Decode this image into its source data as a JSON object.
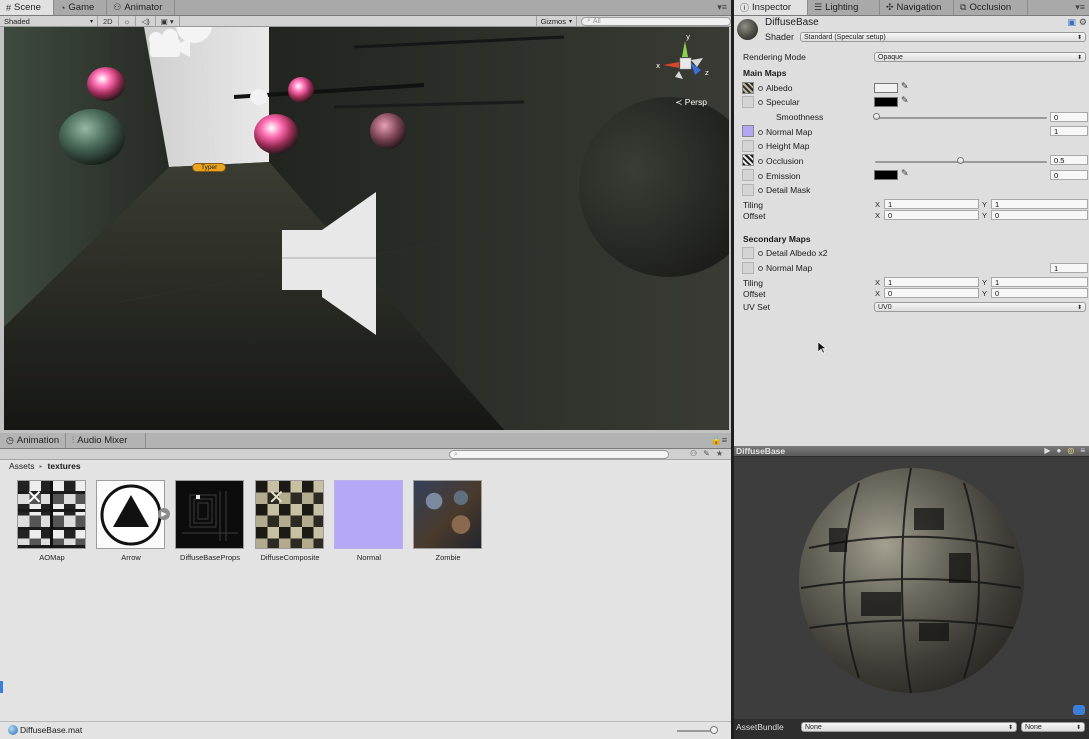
{
  "scene_panel": {
    "tabs": [
      {
        "label": "Scene",
        "icon": "scene-grid-icon",
        "active": true
      },
      {
        "label": "Game",
        "icon": "game-pacman-icon",
        "active": false
      },
      {
        "label": "Animator",
        "icon": "animator-icon",
        "active": false
      }
    ],
    "toolbar": {
      "draw_mode": "Shaded",
      "mode_2d": "2D",
      "gizmos": "Gizmos",
      "search_placeholder": "All"
    },
    "viewport": {
      "camera_mode": "Persp",
      "selected_label": "Typer",
      "gizmo_axes": [
        "y",
        "x",
        "z"
      ]
    }
  },
  "inspector": {
    "tabs": [
      {
        "label": "Inspector",
        "active": true
      },
      {
        "label": "Lighting",
        "active": false
      },
      {
        "label": "Navigation",
        "active": false
      },
      {
        "label": "Occlusion",
        "active": false
      }
    ],
    "material_name": "DiffuseBase",
    "shader_label": "Shader",
    "shader_value": "Standard (Specular setup)",
    "rendering_mode_label": "Rendering Mode",
    "rendering_mode_value": "Opaque",
    "main_maps_title": "Main Maps",
    "albedo": "Albedo",
    "specular": "Specular",
    "smoothness": "Smoothness",
    "smoothness_value": "0",
    "normal_map": "Normal Map",
    "normal_map_value": "1",
    "height_map": "Height Map",
    "occlusion": "Occlusion",
    "occlusion_value": "0.5",
    "emission": "Emission",
    "emission_value": "0",
    "detail_mask": "Detail Mask",
    "tiling": "Tiling",
    "offset": "Offset",
    "tiling_x": "1",
    "tiling_y": "1",
    "offset_x": "0",
    "offset_y": "0",
    "x_label": "X",
    "y_label": "Y",
    "secondary_maps_title": "Secondary Maps",
    "detail_albedo": "Detail Albedo x2",
    "secondary_normal_map": "Normal Map",
    "secondary_normal_value": "1",
    "secondary_tiling_x": "1",
    "secondary_tiling_y": "1",
    "secondary_offset_x": "0",
    "secondary_offset_y": "0",
    "uv_set_label": "UV Set",
    "uv_set_value": "UV0",
    "colors": {
      "albedo": "#f2f2f2",
      "specular": "#000000",
      "emission": "#000000",
      "normal_thumb": "#b3a6f5"
    }
  },
  "preview": {
    "title": "DiffuseBase",
    "asset_bundle_label": "AssetBundle",
    "asset_bundle_value": "None",
    "asset_bundle_variant": "None"
  },
  "project": {
    "tabs": [
      {
        "label": "Animation",
        "active": false
      },
      {
        "label": "Audio Mixer",
        "active": false
      }
    ],
    "breadcrumb": [
      "Assets",
      "textures"
    ],
    "assets": [
      {
        "name": "AOMap"
      },
      {
        "name": "Arrow"
      },
      {
        "name": "DiffuseBaseProps"
      },
      {
        "name": "DiffuseComposite"
      },
      {
        "name": "Normal"
      },
      {
        "name": "Zombie"
      }
    ],
    "status_text": "DiffuseBase.mat"
  }
}
